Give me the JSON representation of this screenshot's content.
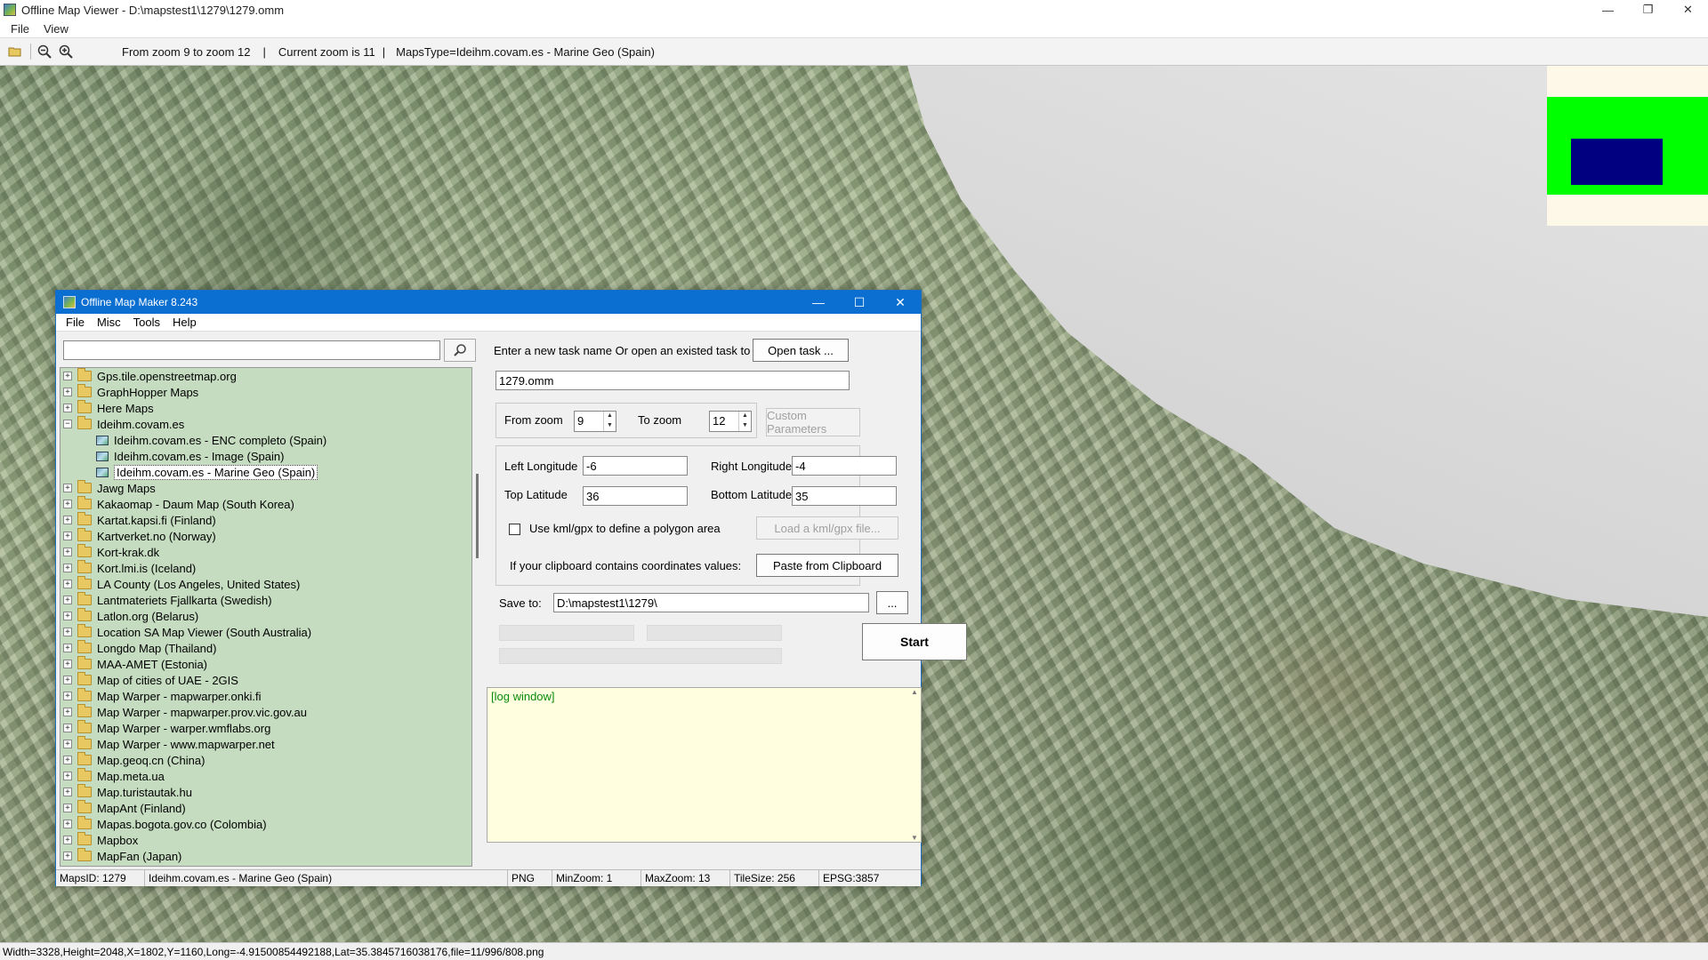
{
  "viewer": {
    "title": "Offline Map Viewer - D:\\mapstest1\\1279\\1279.omm",
    "window_controls": {
      "minimize": "—",
      "restore": "❐",
      "close": "✕"
    },
    "menu": [
      "File",
      "View"
    ],
    "toolbar": {
      "open_icon": "folder-open-icon",
      "zoom_out_icon": "zoom-out-icon",
      "zoom_in_icon": "zoom-in-icon",
      "zoom_range": "From zoom 9 to zoom 12",
      "current_zoom": "Current zoom is 11",
      "maps_type": "MapsType=Ideihm.covam.es - Marine Geo (Spain)",
      "separator": "|"
    },
    "status": "Width=3328,Height=2048,X=1802,Y=1160,Long=-4.91500854492188,Lat=35.3845716038176,file=11/996/808.png",
    "minimap_colors": {
      "background": "#fdf8e8",
      "area": "#00ff00",
      "viewport": "#000080"
    }
  },
  "dialog": {
    "title": "Offline Map Maker 8.243",
    "window_controls": {
      "minimize": "—",
      "maximize": "☐",
      "close": "✕"
    },
    "menu": [
      "File",
      "Misc",
      "Tools",
      "Help"
    ],
    "search": {
      "value": "",
      "icon": "search-icon"
    },
    "tree": [
      {
        "label": "Gps.tile.openstreetmap.org",
        "type": "folder",
        "expanded": false
      },
      {
        "label": "GraphHopper Maps",
        "type": "folder",
        "expanded": false
      },
      {
        "label": "Here Maps",
        "type": "folder",
        "expanded": false
      },
      {
        "label": "Ideihm.covam.es",
        "type": "folder",
        "expanded": true
      },
      {
        "label": "Ideihm.covam.es - ENC completo (Spain)",
        "type": "map",
        "child": true
      },
      {
        "label": "Ideihm.covam.es - Image (Spain)",
        "type": "map",
        "child": true
      },
      {
        "label": "Ideihm.covam.es - Marine Geo (Spain)",
        "type": "map",
        "child": true,
        "selected": true
      },
      {
        "label": "Jawg Maps",
        "type": "folder",
        "expanded": false
      },
      {
        "label": "Kakaomap - Daum Map (South Korea)",
        "type": "folder",
        "expanded": false
      },
      {
        "label": "Kartat.kapsi.fi (Finland)",
        "type": "folder",
        "expanded": false
      },
      {
        "label": "Kartverket.no (Norway)",
        "type": "folder",
        "expanded": false
      },
      {
        "label": "Kort-krak.dk",
        "type": "folder",
        "expanded": false
      },
      {
        "label": "Kort.lmi.is (Iceland)",
        "type": "folder",
        "expanded": false
      },
      {
        "label": "LA County (Los Angeles, United States)",
        "type": "folder",
        "expanded": false
      },
      {
        "label": "Lantmateriets Fjallkarta (Swedish)",
        "type": "folder",
        "expanded": false
      },
      {
        "label": "Latlon.org (Belarus)",
        "type": "folder",
        "expanded": false
      },
      {
        "label": "Location SA Map Viewer (South Australia)",
        "type": "folder",
        "expanded": false
      },
      {
        "label": "Longdo Map (Thailand)",
        "type": "folder",
        "expanded": false
      },
      {
        "label": "MAA-AMET (Estonia)",
        "type": "folder",
        "expanded": false
      },
      {
        "label": "Map of cities of UAE - 2GIS",
        "type": "folder",
        "expanded": false
      },
      {
        "label": "Map Warper - mapwarper.onki.fi",
        "type": "folder",
        "expanded": false
      },
      {
        "label": "Map Warper - mapwarper.prov.vic.gov.au",
        "type": "folder",
        "expanded": false
      },
      {
        "label": "Map Warper - warper.wmflabs.org",
        "type": "folder",
        "expanded": false
      },
      {
        "label": "Map Warper - www.mapwarper.net",
        "type": "folder",
        "expanded": false
      },
      {
        "label": "Map.geoq.cn (China)",
        "type": "folder",
        "expanded": false
      },
      {
        "label": "Map.meta.ua",
        "type": "folder",
        "expanded": false
      },
      {
        "label": "Map.turistautak.hu",
        "type": "folder",
        "expanded": false
      },
      {
        "label": "MapAnt (Finland)",
        "type": "folder",
        "expanded": false
      },
      {
        "label": "Mapas.bogota.gov.co (Colombia)",
        "type": "folder",
        "expanded": false
      },
      {
        "label": "Mapbox",
        "type": "folder",
        "expanded": false
      },
      {
        "label": "MapFan (Japan)",
        "type": "folder",
        "expanded": false
      }
    ],
    "task": {
      "prompt": "Enter a new task name Or open an existed task to continue:",
      "open_button": "Open task ...",
      "name_value": "1279.omm"
    },
    "zoom": {
      "from_label": "From zoom",
      "from_value": "9",
      "to_label": "To zoom",
      "to_value": "12",
      "custom_button": "Custom Parameters"
    },
    "coords": {
      "left_label": "Left Longitude",
      "left_value": "-6",
      "right_label": "Right Longitude",
      "right_value": "-4",
      "top_label": "Top Latitude",
      "top_value": "36",
      "bottom_label": "Bottom Latitude",
      "bottom_value": "35",
      "kml_checkbox_label": "Use kml/gpx to define a polygon area",
      "kml_checked": false,
      "load_kml_button": "Load a kml/gpx file...",
      "clipboard_label": "If your clipboard contains coordinates values:",
      "paste_button": "Paste from Clipboard"
    },
    "save": {
      "label": "Save to:",
      "value": "D:\\mapstest1\\1279\\",
      "browse_button": "...",
      "start_button": "Start"
    },
    "log": {
      "text": "[log window]"
    },
    "status": {
      "maps_id": "MapsID: 1279",
      "map_name": "Ideihm.covam.es - Marine Geo (Spain)",
      "format": "PNG",
      "min_zoom": "MinZoom: 1",
      "max_zoom": "MaxZoom: 13",
      "tile_size": "TileSize: 256",
      "epsg": "EPSG:3857"
    }
  }
}
